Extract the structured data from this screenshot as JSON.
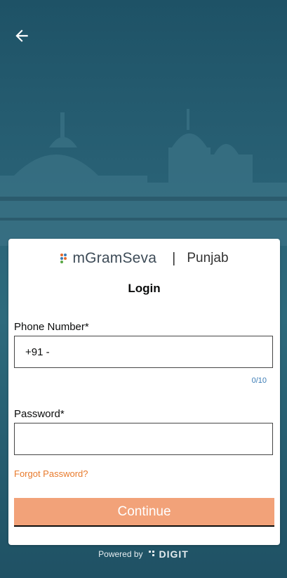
{
  "header": {
    "back_icon": "arrow-left-icon"
  },
  "brand": {
    "app_name": "mGramSeva",
    "separator": "|",
    "state": "Punjab"
  },
  "login": {
    "title": "Login",
    "phone": {
      "label": "Phone Number*",
      "prefix": "+91 -",
      "value": "",
      "counter": "0/10"
    },
    "password": {
      "label": "Password*",
      "value": ""
    },
    "forgot_password": "Forgot Password?",
    "continue_label": "Continue"
  },
  "footer": {
    "powered_by": "Powered by",
    "brand": "DIGIT"
  },
  "colors": {
    "accent": "#f2a279",
    "link": "#e87a2b",
    "counter": "#3a7bb5",
    "background": "#1f5566"
  }
}
